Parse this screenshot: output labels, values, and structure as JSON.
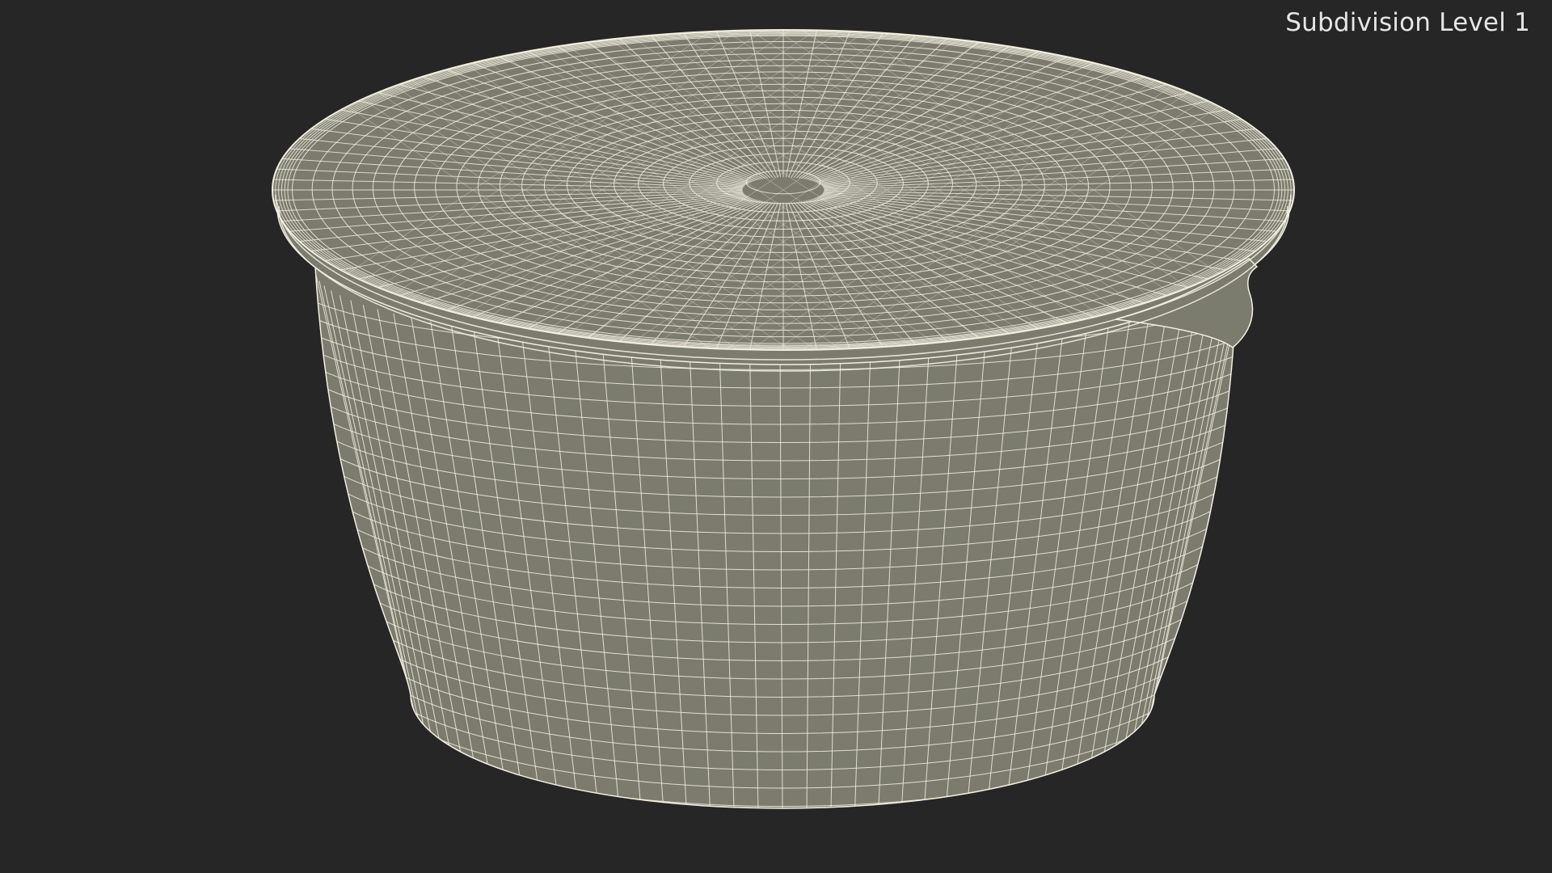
{
  "viewport": {
    "label": "Subdivision Level 1",
    "background_color": "#262626",
    "surface_color": "#7b7b6e",
    "wire_color": "#f3f0e0"
  }
}
